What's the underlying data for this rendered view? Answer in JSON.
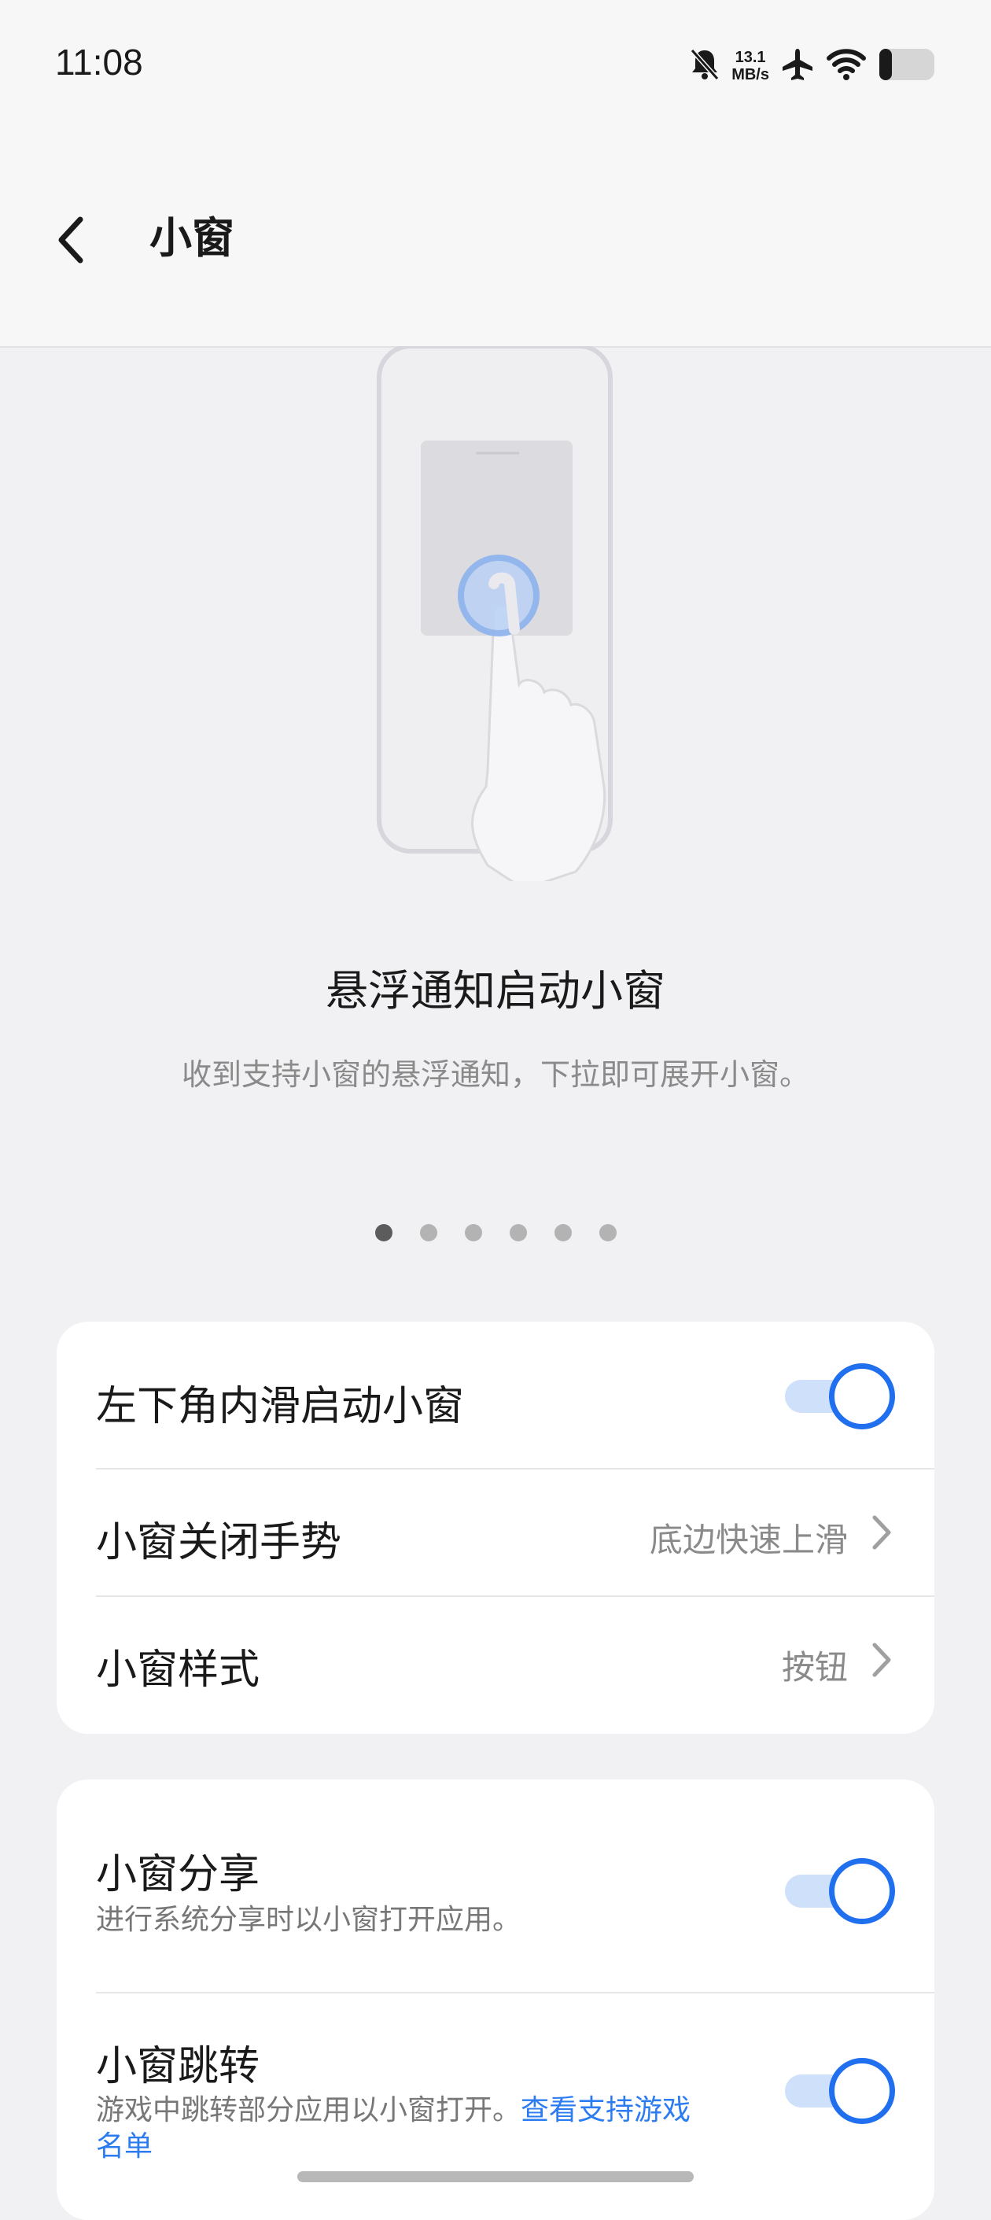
{
  "status_bar": {
    "time": "11:08",
    "net_speed_value": "13.1",
    "net_speed_unit": "MB/s",
    "icons": [
      "bell-muted-icon",
      "airplane-icon",
      "wifi-icon",
      "battery-icon"
    ]
  },
  "header": {
    "title": "小窗",
    "back_icon": "chevron-left-icon"
  },
  "carousel": {
    "title": "悬浮通知启动小窗",
    "description": "收到支持小窗的悬浮通知，下拉即可展开小窗。",
    "page_count": 6,
    "active_index": 0
  },
  "settings_group1": {
    "items": [
      {
        "label": "左下角内滑启动小窗",
        "type": "toggle",
        "enabled": true
      },
      {
        "label": "小窗关闭手势",
        "type": "link",
        "value": "底边快速上滑"
      },
      {
        "label": "小窗样式",
        "type": "link",
        "value": "按钮"
      }
    ]
  },
  "settings_group2": {
    "items": [
      {
        "label": "小窗分享",
        "subtitle": "进行系统分享时以小窗打开应用。",
        "type": "toggle",
        "enabled": true
      },
      {
        "label": "小窗跳转",
        "subtitle": "游戏中跳转部分应用以小窗打开。",
        "link": "查看支持游戏名单",
        "type": "toggle",
        "enabled": true
      }
    ]
  },
  "colors": {
    "accent": "#1f6fef",
    "toggle_track": "#cfe0fa",
    "link": "#2b7bf1",
    "background": "#f1f1f3"
  }
}
